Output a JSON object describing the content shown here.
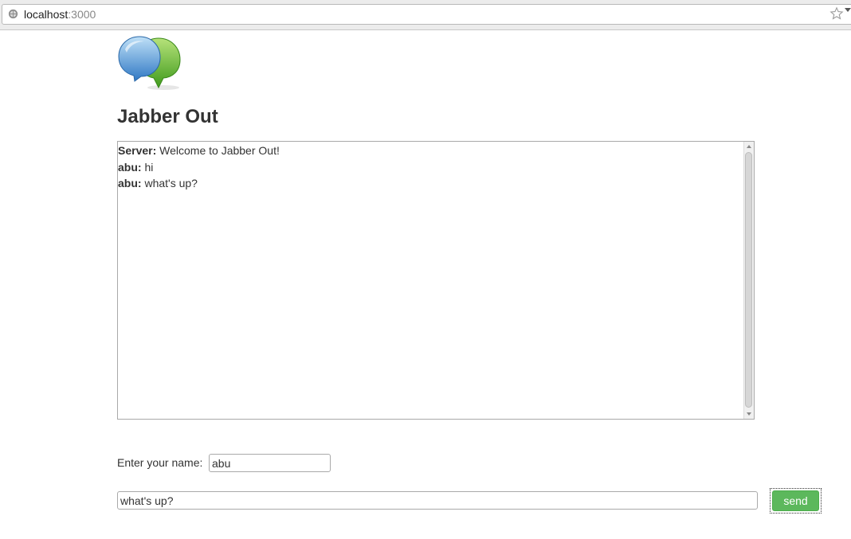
{
  "browser": {
    "url_host": "localhost",
    "url_port": ":3000"
  },
  "page": {
    "title": "Jabber Out"
  },
  "chat": {
    "messages": [
      {
        "sender": "Server:",
        "text": " Welcome to Jabber Out!"
      },
      {
        "sender": "abu:",
        "text": " hi"
      },
      {
        "sender": "abu:",
        "text": " what's up?"
      }
    ]
  },
  "form": {
    "name_label": "Enter your name:",
    "name_value": "abu",
    "message_value": "what's up?",
    "send_label": "send"
  },
  "colors": {
    "send_button": "#5cb85c",
    "logo_blue": "#3a8fd6",
    "logo_green": "#5ab82c"
  },
  "icons": [
    "globe-icon",
    "star-icon",
    "chat-bubbles-logo"
  ]
}
